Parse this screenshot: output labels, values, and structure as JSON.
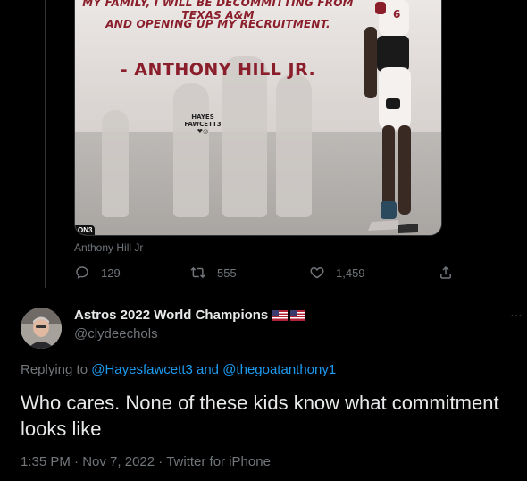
{
  "quoted_tweet": {
    "image": {
      "quote_line_1": "MY FAMILY, I WILL BE DECOMMITTING FROM TEXAS A&M",
      "quote_line_2": "AND OPENING UP MY RECRUITMENT.",
      "quote_author": "- ANTHONY HILL JR.",
      "watermark_line_1": "HAYES",
      "watermark_line_2": "FAWCETT3",
      "watermark_icons": "♥◎",
      "jersey_number": "6",
      "badge": "ON3"
    },
    "caption": "Anthony Hill Jr",
    "actions": {
      "replies": "129",
      "retweets": "555",
      "likes": "1,459"
    }
  },
  "reply": {
    "display_name": "Astros 2022 World Champions",
    "handle": "@clydeechols",
    "replying_to_label": "Replying to",
    "mention_1": "@Hayesfawcett3",
    "and_label": "and",
    "mention_2": "@thegoatanthony1",
    "text": "Who cares.  None of these kids know what commitment looks like",
    "time": "1:35 PM",
    "date": "Nov 7, 2022",
    "source": "Twitter for iPhone",
    "separator": "·",
    "more_glyph": "···"
  },
  "colors": {
    "background": "#000000",
    "text_primary": "#e7e9ea",
    "text_secondary": "#71767b",
    "link": "#1d9bf0",
    "quote_red": "#8a1f2b"
  }
}
